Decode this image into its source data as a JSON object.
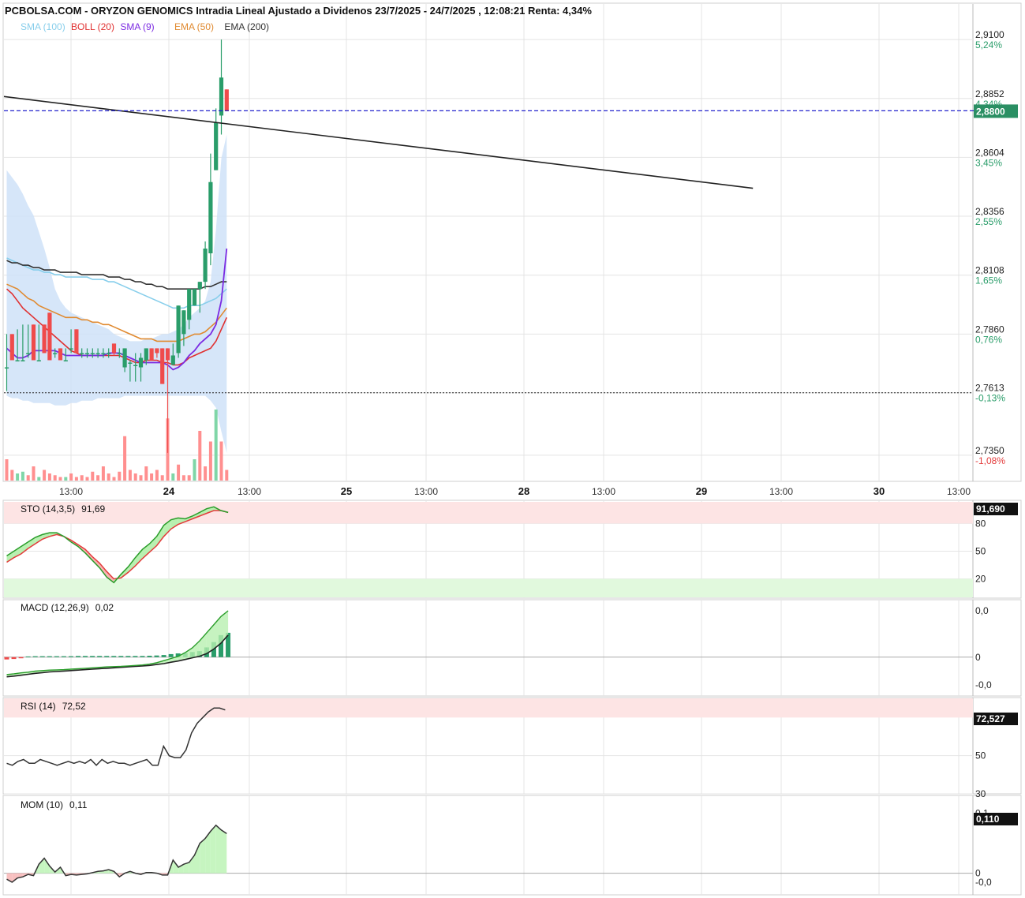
{
  "title": "PCBOLSA.COM - ORYZON GENOMICS Intradia Lineal Ajustado a Dividenos 23/7/2025 - 24/7/2025 , 12:08:21 Renta: 4,34%",
  "legend": [
    {
      "label": "SMA (100)",
      "color": "#87ceeb"
    },
    {
      "label": "BOLL (20)",
      "color": "#e03030"
    },
    {
      "label": "SMA (9)",
      "color": "#7b2be2"
    },
    {
      "label": "EMA (50)",
      "color": "#e08a30"
    },
    {
      "label": "EMA (200)",
      "color": "#333333"
    }
  ],
  "colors": {
    "up": "#2a9d6a",
    "down": "#ef4b4b",
    "last_price_bg": "#2a8f63",
    "boll_fill": "#cfe2f8",
    "grid": "#e4e4e4"
  },
  "chart_data": [
    {
      "type": "candlestick",
      "ylim": [
        2.724,
        2.92
      ],
      "y_ticks": [
        {
          "price": "2,9100",
          "pct": "5,24%",
          "value": 2.91
        },
        {
          "price": "2,8852",
          "pct": "4,34%",
          "value": 2.8852
        },
        {
          "price": "2,8604",
          "pct": "3,45%",
          "value": 2.8604
        },
        {
          "price": "2,8356",
          "pct": "2,55%",
          "value": 2.8356
        },
        {
          "price": "2,8108",
          "pct": "1,65%",
          "value": 2.8108
        },
        {
          "price": "2,7860",
          "pct": "0,76%",
          "value": 2.786
        },
        {
          "price": "2,7613",
          "pct": "-0,13%",
          "value": 2.7613
        },
        {
          "price": "2,7350",
          "pct": "-1,08%",
          "value": 2.735
        }
      ],
      "last_price": {
        "label": "2,8800",
        "value": 2.88
      },
      "reference_price": 2.7613,
      "x_labels": [
        {
          "text": "13:00",
          "bold": false
        },
        {
          "text": "24",
          "bold": true
        },
        {
          "text": "13:00",
          "bold": false
        },
        {
          "text": "25",
          "bold": true
        },
        {
          "text": "13:00",
          "bold": false
        },
        {
          "text": "28",
          "bold": true
        },
        {
          "text": "13:00",
          "bold": false
        },
        {
          "text": "29",
          "bold": true
        },
        {
          "text": "13:00",
          "bold": false
        },
        {
          "text": "30",
          "bold": true
        },
        {
          "text": "13:00",
          "bold": false
        }
      ],
      "candles": [
        [
          2.772,
          2.786,
          2.772,
          2.762
        ],
        [
          2.786,
          2.786,
          2.775,
          2.775
        ],
        [
          2.775,
          2.788,
          2.775,
          2.775
        ],
        [
          2.775,
          2.79,
          2.775,
          2.775
        ],
        [
          2.778,
          2.79,
          2.778,
          2.776
        ],
        [
          2.79,
          2.79,
          2.775,
          2.775
        ],
        [
          2.775,
          2.79,
          2.775,
          2.775
        ],
        [
          2.79,
          2.79,
          2.778,
          2.778
        ],
        [
          2.795,
          2.795,
          2.775,
          2.775
        ],
        [
          2.778,
          2.78,
          2.778,
          2.776
        ],
        [
          2.78,
          2.78,
          2.775,
          2.775
        ],
        [
          2.775,
          2.78,
          2.775,
          2.775
        ],
        [
          2.78,
          2.788,
          2.78,
          2.778
        ],
        [
          2.788,
          2.788,
          2.778,
          2.778
        ],
        [
          2.778,
          2.78,
          2.778,
          2.776
        ],
        [
          2.778,
          2.78,
          2.778,
          2.776
        ],
        [
          2.778,
          2.78,
          2.778,
          2.776
        ],
        [
          2.778,
          2.78,
          2.778,
          2.776
        ],
        [
          2.778,
          2.78,
          2.778,
          2.776
        ],
        [
          2.778,
          2.78,
          2.778,
          2.776
        ],
        [
          2.782,
          2.782,
          2.778,
          2.777
        ],
        [
          2.778,
          2.78,
          2.778,
          2.776
        ],
        [
          2.772,
          2.78,
          2.78,
          2.77
        ],
        [
          2.774,
          2.775,
          2.774,
          2.766
        ],
        [
          2.773,
          2.778,
          2.773,
          2.766
        ],
        [
          2.772,
          2.778,
          2.776,
          2.766
        ],
        [
          2.775,
          2.78,
          2.78,
          2.773
        ],
        [
          2.78,
          2.78,
          2.775,
          2.775
        ],
        [
          2.78,
          2.78,
          2.778,
          2.776
        ],
        [
          2.78,
          2.78,
          2.765,
          2.765
        ],
        [
          2.78,
          2.78,
          2.775,
          2.736
        ],
        [
          2.773,
          2.782,
          2.777,
          2.773
        ],
        [
          2.778,
          2.798,
          2.798,
          2.776
        ],
        [
          2.786,
          2.796,
          2.796,
          2.781
        ],
        [
          2.792,
          2.805,
          2.805,
          2.788
        ],
        [
          2.798,
          2.805,
          2.805,
          2.798
        ],
        [
          2.805,
          2.808,
          2.808,
          2.795
        ],
        [
          2.808,
          2.825,
          2.822,
          2.805
        ],
        [
          2.82,
          2.862,
          2.85,
          2.815
        ],
        [
          2.855,
          2.881,
          2.875,
          2.855
        ],
        [
          2.878,
          2.91,
          2.894,
          2.87
        ],
        [
          2.889,
          2.889,
          2.88,
          2.88
        ]
      ],
      "sma100": [
        2.818,
        2.817,
        2.816,
        2.815,
        2.814,
        2.813,
        2.813,
        2.812,
        2.812,
        2.811,
        2.811,
        2.81,
        2.81,
        2.81,
        2.81,
        2.81,
        2.809,
        2.809,
        2.809,
        2.808,
        2.808,
        2.807,
        2.806,
        2.805,
        2.804,
        2.803,
        2.802,
        2.801,
        2.8,
        2.799,
        2.798,
        2.797,
        2.797,
        2.797,
        2.798,
        2.798,
        2.798,
        2.799,
        2.8,
        2.801,
        2.803,
        2.805
      ],
      "ema200": [
        2.817,
        2.816,
        2.816,
        2.815,
        2.815,
        2.814,
        2.814,
        2.813,
        2.813,
        2.813,
        2.812,
        2.812,
        2.812,
        2.812,
        2.811,
        2.811,
        2.811,
        2.811,
        2.811,
        2.81,
        2.81,
        2.81,
        2.809,
        2.809,
        2.808,
        2.808,
        2.807,
        2.807,
        2.806,
        2.806,
        2.805,
        2.805,
        2.805,
        2.805,
        2.805,
        2.805,
        2.805,
        2.806,
        2.806,
        2.807,
        2.808,
        2.808
      ],
      "ema50": [
        2.807,
        2.806,
        2.805,
        2.803,
        2.801,
        2.8,
        2.798,
        2.797,
        2.796,
        2.795,
        2.794,
        2.793,
        2.793,
        2.793,
        2.792,
        2.792,
        2.791,
        2.791,
        2.79,
        2.79,
        2.789,
        2.788,
        2.787,
        2.786,
        2.785,
        2.784,
        2.784,
        2.784,
        2.783,
        2.783,
        2.783,
        2.783,
        2.783,
        2.784,
        2.785,
        2.786,
        2.786,
        2.787,
        2.789,
        2.791,
        2.794,
        2.797
      ],
      "sma9": [
        2.78,
        2.778,
        2.776,
        2.776,
        2.777,
        2.779,
        2.779,
        2.779,
        2.779,
        2.779,
        2.778,
        2.777,
        2.777,
        2.777,
        2.777,
        2.777,
        2.777,
        2.777,
        2.777,
        2.778,
        2.778,
        2.778,
        2.777,
        2.776,
        2.775,
        2.774,
        2.774,
        2.774,
        2.774,
        2.774,
        2.773,
        2.771,
        2.772,
        2.774,
        2.777,
        2.779,
        2.782,
        2.784,
        2.786,
        2.79,
        2.8,
        2.822
      ],
      "boll_mid": [
        2.805,
        2.803,
        2.8,
        2.797,
        2.795,
        2.793,
        2.791,
        2.789,
        2.787,
        2.785,
        2.783,
        2.781,
        2.779,
        2.778,
        2.777,
        2.777,
        2.777,
        2.777,
        2.777,
        2.777,
        2.777,
        2.777,
        2.776,
        2.775,
        2.774,
        2.774,
        2.775,
        2.775,
        2.775,
        2.774,
        2.774,
        2.773,
        2.773,
        2.774,
        2.776,
        2.777,
        2.778,
        2.779,
        2.78,
        2.783,
        2.788,
        2.793
      ],
      "boll_upper": [
        2.855,
        2.852,
        2.849,
        2.845,
        2.84,
        2.836,
        2.829,
        2.822,
        2.814,
        2.805,
        2.8,
        2.797,
        2.795,
        2.794,
        2.793,
        2.792,
        2.791,
        2.79,
        2.789,
        2.788,
        2.786,
        2.785,
        2.784,
        2.783,
        2.783,
        2.783,
        2.784,
        2.784,
        2.785,
        2.786,
        2.786,
        2.787,
        2.788,
        2.79,
        2.793,
        2.795,
        2.797,
        2.8,
        2.808,
        2.83,
        2.86,
        2.87
      ],
      "boll_lower": [
        2.76,
        2.759,
        2.759,
        2.758,
        2.758,
        2.757,
        2.757,
        2.757,
        2.757,
        2.756,
        2.756,
        2.756,
        2.757,
        2.757,
        2.758,
        2.758,
        2.758,
        2.759,
        2.759,
        2.759,
        2.759,
        2.759,
        2.76,
        2.76,
        2.76,
        2.76,
        2.76,
        2.76,
        2.76,
        2.76,
        2.76,
        2.76,
        2.76,
        2.76,
        2.76,
        2.76,
        2.76,
        2.76,
        2.758,
        2.755,
        2.745,
        2.736
      ],
      "volume": [
        12,
        6,
        4,
        5,
        3,
        8,
        2,
        6,
        4,
        3,
        2,
        2,
        4,
        2,
        3,
        2,
        5,
        3,
        8,
        4,
        2,
        5,
        25,
        6,
        4,
        3,
        8,
        4,
        6,
        3,
        35,
        4,
        9,
        3,
        3,
        12,
        28,
        8,
        22,
        40,
        22,
        6
      ],
      "trend_line": {
        "from": [
          0,
          2.886
        ],
        "to": [
          229,
          2.8474
        ]
      }
    },
    {
      "type": "stochastic",
      "label": "STO (14,3,5)",
      "value_label": "91,69",
      "badge": "91,690",
      "ylim": [
        0,
        100
      ],
      "zones": {
        "upper": 80,
        "lower": 20
      },
      "ticks": [
        {
          "text": "80",
          "value": 80
        },
        {
          "text": "50",
          "value": 50
        },
        {
          "text": "20",
          "value": 20
        }
      ],
      "k": [
        45,
        50,
        55,
        60,
        65,
        68,
        70,
        70,
        66,
        60,
        55,
        48,
        40,
        32,
        22,
        16,
        25,
        33,
        43,
        52,
        58,
        66,
        78,
        84,
        86,
        85,
        88,
        92,
        96,
        98,
        94,
        92
      ],
      "d": [
        38,
        43,
        47,
        53,
        58,
        63,
        66,
        68,
        66,
        62,
        57,
        52,
        44,
        37,
        28,
        20,
        21,
        27,
        34,
        42,
        49,
        56,
        66,
        74,
        79,
        82,
        85,
        88,
        91,
        94,
        94,
        92
      ]
    },
    {
      "type": "macd",
      "label": "MACD (12,26,9)",
      "value_label": "0,02",
      "ylim": [
        -0.012,
        0.02
      ],
      "ticks": [
        {
          "text": "0,0",
          "value": 0.02,
          "color": "#d62020"
        },
        {
          "text": "0",
          "value": 0,
          "color": "#111111"
        },
        {
          "text": "-0,0",
          "value": -0.012,
          "color": "#1a7a1a"
        }
      ],
      "macd": [
        -0.0075,
        -0.0072,
        -0.0068,
        -0.0065,
        -0.006,
        -0.0058,
        -0.0056,
        -0.0055,
        -0.0054,
        -0.0052,
        -0.005,
        -0.0048,
        -0.0046,
        -0.0044,
        -0.0042,
        -0.0041,
        -0.004,
        -0.0038,
        -0.0036,
        -0.0034,
        -0.003,
        -0.0024,
        -0.0015,
        -0.0006,
        0.0003,
        0.002,
        0.004,
        0.007,
        0.0105,
        0.014,
        0.0175,
        0.02
      ],
      "signal": [
        -0.0085,
        -0.0082,
        -0.0078,
        -0.0074,
        -0.007,
        -0.0067,
        -0.0064,
        -0.0062,
        -0.006,
        -0.0058,
        -0.0056,
        -0.0054,
        -0.0052,
        -0.005,
        -0.0048,
        -0.0046,
        -0.0044,
        -0.0042,
        -0.004,
        -0.0038,
        -0.0036,
        -0.0032,
        -0.0028,
        -0.0022,
        -0.0017,
        -0.001,
        -0.0003,
        0.0004,
        0.0015,
        0.0035,
        0.006,
        0.0095
      ],
      "hist": [
        -0.001,
        -0.0008,
        -0.0005,
        0.0003,
        0.0004,
        0.0004,
        0.0004,
        0.0004,
        0.0004,
        0.0004,
        0.0005,
        0.0005,
        0.0005,
        0.0005,
        0.0005,
        0.0005,
        0.0005,
        0.0005,
        0.0005,
        0.0005,
        0.0006,
        0.0007,
        0.0009,
        0.0013,
        0.0016,
        0.0018,
        0.0022,
        0.0026,
        0.0042,
        0.0065,
        0.0095,
        0.0105
      ]
    },
    {
      "type": "line",
      "label": "RSI (14)",
      "value_label": "72,52",
      "badge": "72,527",
      "ylim": [
        30,
        78
      ],
      "zone_upper": 70,
      "ticks": [
        {
          "text": "50",
          "value": 50
        },
        {
          "text": "30",
          "value": 30
        }
      ],
      "values": [
        46,
        45,
        47,
        48,
        46,
        46,
        48,
        47,
        46,
        45,
        46,
        47,
        46,
        47,
        46,
        48,
        45,
        48,
        46,
        47,
        46,
        46,
        45,
        46,
        47,
        48,
        45,
        45,
        55,
        50,
        49,
        49,
        53,
        62,
        67,
        70,
        73,
        75,
        75,
        74
      ]
    },
    {
      "type": "area",
      "label": "MOM (10)",
      "value_label": "0,11",
      "badge": "0,110",
      "ylim": [
        -0.015,
        0.11
      ],
      "ticks": [
        {
          "text": "0,1",
          "value": 0.1,
          "color": "#d62020"
        },
        {
          "text": "0",
          "value": 0,
          "color": "#111111"
        },
        {
          "text": "-0,0",
          "value": -0.015,
          "color": "#1a7a1a"
        }
      ],
      "values": [
        -0.01,
        -0.015,
        -0.008,
        -0.006,
        -0.002,
        -0.004,
        0.015,
        0.025,
        0.012,
        0.002,
        0.01,
        -0.004,
        -0.002,
        -0.003,
        -0.002,
        -0.001,
        0.001,
        0.003,
        0.004,
        0.006,
        0.003,
        -0.006,
        0.0,
        0.003,
        0.0,
        -0.002,
        0.001,
        0.001,
        0.0,
        -0.003,
        -0.003,
        0.022,
        0.01,
        0.015,
        0.018,
        0.03,
        0.05,
        0.058,
        0.07,
        0.08,
        0.072,
        0.066
      ]
    }
  ]
}
